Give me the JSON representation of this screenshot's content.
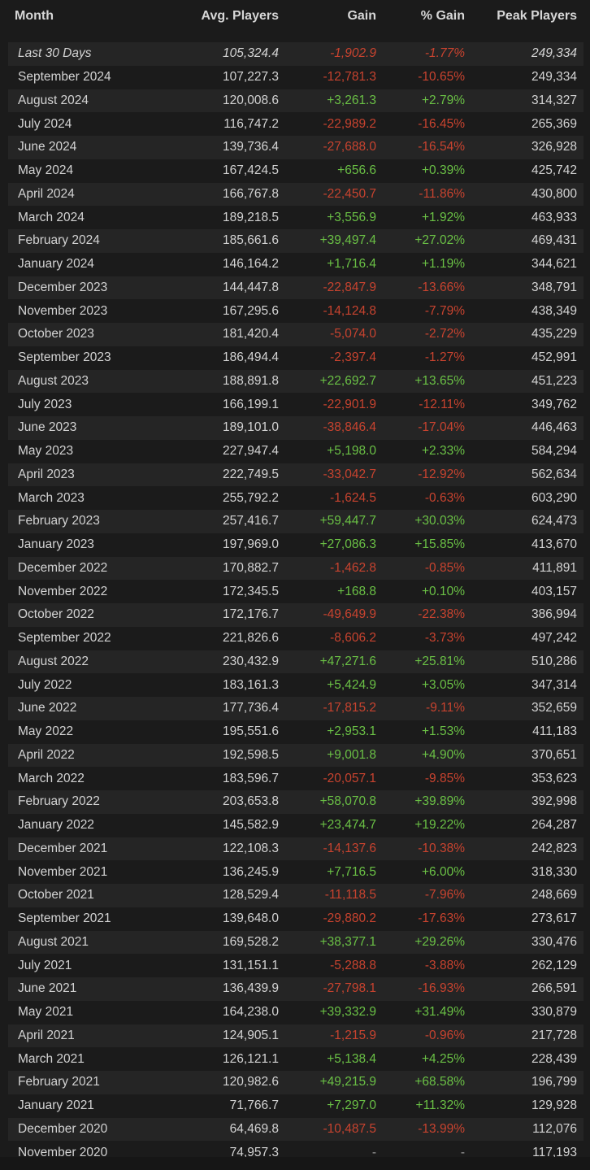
{
  "header": {
    "month": "Month",
    "avg_players": "Avg. Players",
    "gain": "Gain",
    "pct_gain": "% Gain",
    "peak_players": "Peak Players"
  },
  "rows": [
    {
      "month": "Last 30 Days",
      "avg": "105,324.4",
      "gain": "-1,902.9",
      "pct": "-1.77%",
      "peak": "249,334",
      "italic": true
    },
    {
      "month": "September 2024",
      "avg": "107,227.3",
      "gain": "-12,781.3",
      "pct": "-10.65%",
      "peak": "249,334"
    },
    {
      "month": "August 2024",
      "avg": "120,008.6",
      "gain": "+3,261.3",
      "pct": "+2.79%",
      "peak": "314,327"
    },
    {
      "month": "July 2024",
      "avg": "116,747.2",
      "gain": "-22,989.2",
      "pct": "-16.45%",
      "peak": "265,369"
    },
    {
      "month": "June 2024",
      "avg": "139,736.4",
      "gain": "-27,688.0",
      "pct": "-16.54%",
      "peak": "326,928"
    },
    {
      "month": "May 2024",
      "avg": "167,424.5",
      "gain": "+656.6",
      "pct": "+0.39%",
      "peak": "425,742"
    },
    {
      "month": "April 2024",
      "avg": "166,767.8",
      "gain": "-22,450.7",
      "pct": "-11.86%",
      "peak": "430,800"
    },
    {
      "month": "March 2024",
      "avg": "189,218.5",
      "gain": "+3,556.9",
      "pct": "+1.92%",
      "peak": "463,933"
    },
    {
      "month": "February 2024",
      "avg": "185,661.6",
      "gain": "+39,497.4",
      "pct": "+27.02%",
      "peak": "469,431"
    },
    {
      "month": "January 2024",
      "avg": "146,164.2",
      "gain": "+1,716.4",
      "pct": "+1.19%",
      "peak": "344,621"
    },
    {
      "month": "December 2023",
      "avg": "144,447.8",
      "gain": "-22,847.9",
      "pct": "-13.66%",
      "peak": "348,791"
    },
    {
      "month": "November 2023",
      "avg": "167,295.6",
      "gain": "-14,124.8",
      "pct": "-7.79%",
      "peak": "438,349"
    },
    {
      "month": "October 2023",
      "avg": "181,420.4",
      "gain": "-5,074.0",
      "pct": "-2.72%",
      "peak": "435,229"
    },
    {
      "month": "September 2023",
      "avg": "186,494.4",
      "gain": "-2,397.4",
      "pct": "-1.27%",
      "peak": "452,991"
    },
    {
      "month": "August 2023",
      "avg": "188,891.8",
      "gain": "+22,692.7",
      "pct": "+13.65%",
      "peak": "451,223"
    },
    {
      "month": "July 2023",
      "avg": "166,199.1",
      "gain": "-22,901.9",
      "pct": "-12.11%",
      "peak": "349,762"
    },
    {
      "month": "June 2023",
      "avg": "189,101.0",
      "gain": "-38,846.4",
      "pct": "-17.04%",
      "peak": "446,463"
    },
    {
      "month": "May 2023",
      "avg": "227,947.4",
      "gain": "+5,198.0",
      "pct": "+2.33%",
      "peak": "584,294"
    },
    {
      "month": "April 2023",
      "avg": "222,749.5",
      "gain": "-33,042.7",
      "pct": "-12.92%",
      "peak": "562,634"
    },
    {
      "month": "March 2023",
      "avg": "255,792.2",
      "gain": "-1,624.5",
      "pct": "-0.63%",
      "peak": "603,290"
    },
    {
      "month": "February 2023",
      "avg": "257,416.7",
      "gain": "+59,447.7",
      "pct": "+30.03%",
      "peak": "624,473"
    },
    {
      "month": "January 2023",
      "avg": "197,969.0",
      "gain": "+27,086.3",
      "pct": "+15.85%",
      "peak": "413,670"
    },
    {
      "month": "December 2022",
      "avg": "170,882.7",
      "gain": "-1,462.8",
      "pct": "-0.85%",
      "peak": "411,891"
    },
    {
      "month": "November 2022",
      "avg": "172,345.5",
      "gain": "+168.8",
      "pct": "+0.10%",
      "peak": "403,157"
    },
    {
      "month": "October 2022",
      "avg": "172,176.7",
      "gain": "-49,649.9",
      "pct": "-22.38%",
      "peak": "386,994"
    },
    {
      "month": "September 2022",
      "avg": "221,826.6",
      "gain": "-8,606.2",
      "pct": "-3.73%",
      "peak": "497,242"
    },
    {
      "month": "August 2022",
      "avg": "230,432.9",
      "gain": "+47,271.6",
      "pct": "+25.81%",
      "peak": "510,286"
    },
    {
      "month": "July 2022",
      "avg": "183,161.3",
      "gain": "+5,424.9",
      "pct": "+3.05%",
      "peak": "347,314"
    },
    {
      "month": "June 2022",
      "avg": "177,736.4",
      "gain": "-17,815.2",
      "pct": "-9.11%",
      "peak": "352,659"
    },
    {
      "month": "May 2022",
      "avg": "195,551.6",
      "gain": "+2,953.1",
      "pct": "+1.53%",
      "peak": "411,183"
    },
    {
      "month": "April 2022",
      "avg": "192,598.5",
      "gain": "+9,001.8",
      "pct": "+4.90%",
      "peak": "370,651"
    },
    {
      "month": "March 2022",
      "avg": "183,596.7",
      "gain": "-20,057.1",
      "pct": "-9.85%",
      "peak": "353,623"
    },
    {
      "month": "February 2022",
      "avg": "203,653.8",
      "gain": "+58,070.8",
      "pct": "+39.89%",
      "peak": "392,998"
    },
    {
      "month": "January 2022",
      "avg": "145,582.9",
      "gain": "+23,474.7",
      "pct": "+19.22%",
      "peak": "264,287"
    },
    {
      "month": "December 2021",
      "avg": "122,108.3",
      "gain": "-14,137.6",
      "pct": "-10.38%",
      "peak": "242,823"
    },
    {
      "month": "November 2021",
      "avg": "136,245.9",
      "gain": "+7,716.5",
      "pct": "+6.00%",
      "peak": "318,330"
    },
    {
      "month": "October 2021",
      "avg": "128,529.4",
      "gain": "-11,118.5",
      "pct": "-7.96%",
      "peak": "248,669"
    },
    {
      "month": "September 2021",
      "avg": "139,648.0",
      "gain": "-29,880.2",
      "pct": "-17.63%",
      "peak": "273,617"
    },
    {
      "month": "August 2021",
      "avg": "169,528.2",
      "gain": "+38,377.1",
      "pct": "+29.26%",
      "peak": "330,476"
    },
    {
      "month": "July 2021",
      "avg": "131,151.1",
      "gain": "-5,288.8",
      "pct": "-3.88%",
      "peak": "262,129"
    },
    {
      "month": "June 2021",
      "avg": "136,439.9",
      "gain": "-27,798.1",
      "pct": "-16.93%",
      "peak": "266,591"
    },
    {
      "month": "May 2021",
      "avg": "164,238.0",
      "gain": "+39,332.9",
      "pct": "+31.49%",
      "peak": "330,879"
    },
    {
      "month": "April 2021",
      "avg": "124,905.1",
      "gain": "-1,215.9",
      "pct": "-0.96%",
      "peak": "217,728"
    },
    {
      "month": "March 2021",
      "avg": "126,121.1",
      "gain": "+5,138.4",
      "pct": "+4.25%",
      "peak": "228,439"
    },
    {
      "month": "February 2021",
      "avg": "120,982.6",
      "gain": "+49,215.9",
      "pct": "+68.58%",
      "peak": "196,799"
    },
    {
      "month": "January 2021",
      "avg": "71,766.7",
      "gain": "+7,297.0",
      "pct": "+11.32%",
      "peak": "129,928"
    },
    {
      "month": "December 2020",
      "avg": "64,469.8",
      "gain": "-10,487.5",
      "pct": "-13.99%",
      "peak": "112,076"
    },
    {
      "month": "November 2020",
      "avg": "74,957.3",
      "gain": "-",
      "pct": "-",
      "peak": "117,193"
    }
  ],
  "colors": {
    "positive": "#6ac045",
    "negative": "#c8432f",
    "neutral": "#9a9a9a",
    "row_odd": "#252525",
    "row_even": "#1b1b1b"
  }
}
